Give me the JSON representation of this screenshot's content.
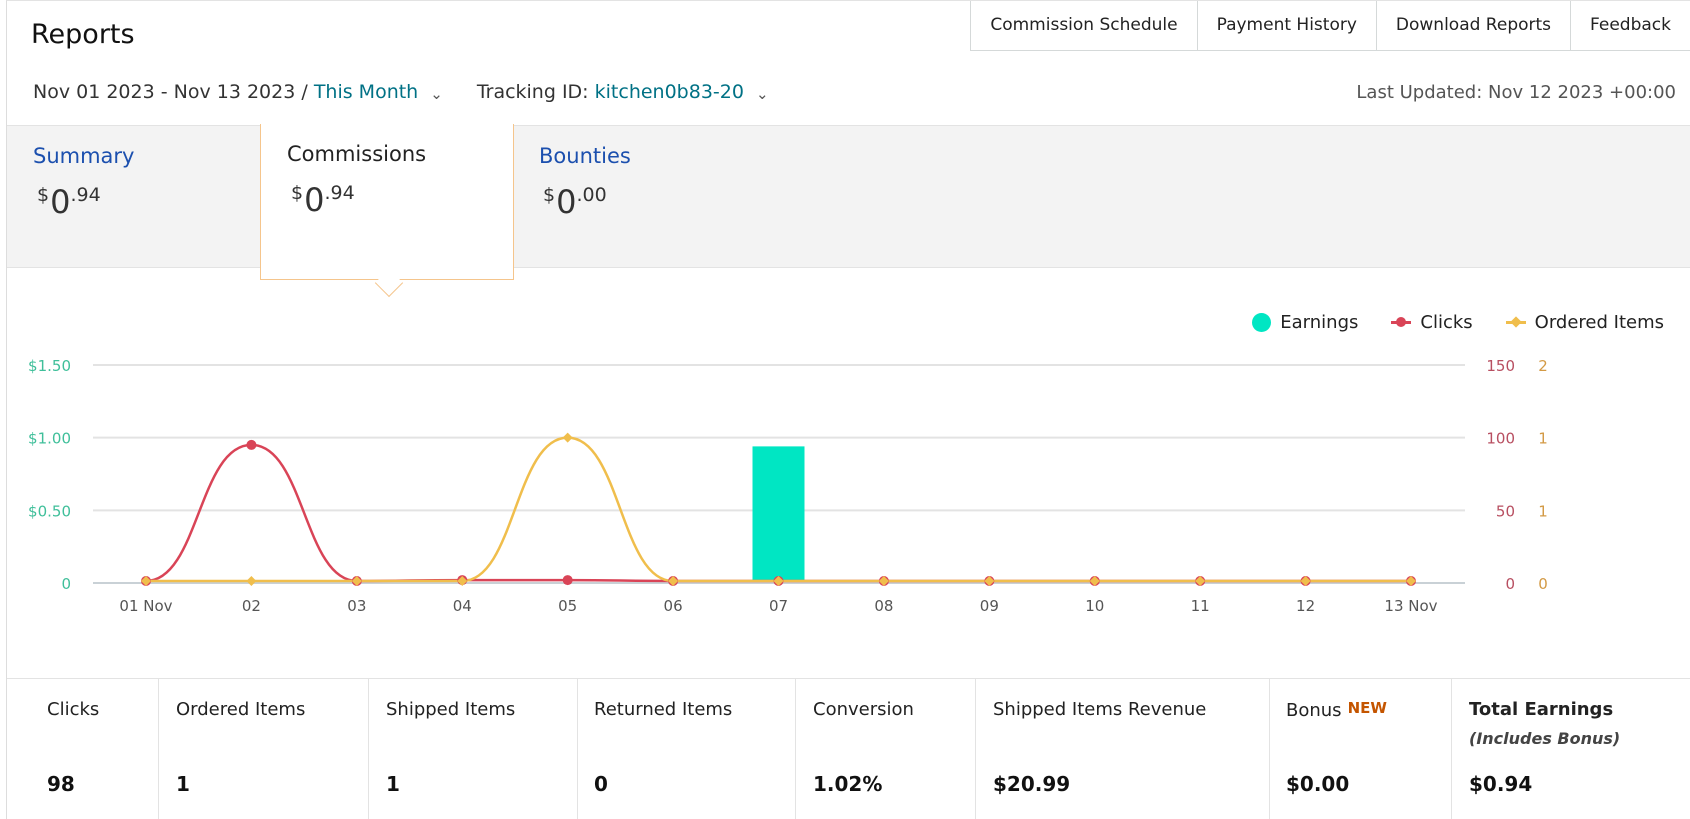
{
  "header": {
    "title": "Reports",
    "nav": [
      "Commission Schedule",
      "Payment History",
      "Download Reports",
      "Feedback"
    ]
  },
  "filters": {
    "date_range": "Nov 01 2023 - Nov 13 2023 / ",
    "period": "This Month",
    "tracking_label": "Tracking ID: ",
    "tracking_id": "kitchen0b83-20",
    "last_updated": "Last Updated: Nov 12 2023 +00:00"
  },
  "tabs": {
    "summary": {
      "label": "Summary",
      "currency": "$",
      "whole": "0",
      "cents": ".94"
    },
    "commissions": {
      "label": "Commissions",
      "currency": "$",
      "whole": "0",
      "cents": ".94"
    },
    "bounties": {
      "label": "Bounties",
      "currency": "$",
      "whole": "0",
      "cents": ".00"
    }
  },
  "legend": {
    "earnings": "Earnings",
    "clicks": "Clicks",
    "ordered": "Ordered Items"
  },
  "colors": {
    "earnings": "#00e6c3",
    "clicks": "#d94457",
    "ordered": "#f0be4c",
    "link": "#007185",
    "tab_link": "#1b4fae",
    "new_badge": "#c45500"
  },
  "chart_data": {
    "type": "bar",
    "categories": [
      "01 Nov",
      "02",
      "03",
      "04",
      "05",
      "06",
      "07",
      "08",
      "09",
      "10",
      "11",
      "12",
      "13 Nov"
    ],
    "series": [
      {
        "name": "Earnings",
        "type": "bar",
        "axis": "left",
        "values": [
          0,
          0,
          0,
          0,
          0,
          0,
          0.94,
          0,
          0,
          0,
          0,
          0,
          0
        ]
      },
      {
        "name": "Clicks",
        "type": "line",
        "axis": "right1",
        "values": [
          0,
          95,
          0,
          2,
          2,
          0,
          0,
          0,
          0,
          0,
          0,
          0,
          0
        ]
      },
      {
        "name": "Ordered Items",
        "type": "line",
        "axis": "right2",
        "values": [
          0,
          0,
          0,
          0,
          1,
          0,
          0,
          0,
          0,
          0,
          0,
          0,
          0
        ]
      }
    ],
    "y_left": {
      "ticks": [
        "0",
        "$0.50",
        "$1.00",
        "$1.50"
      ],
      "range": [
        0,
        1.5
      ]
    },
    "y_right1": {
      "ticks": [
        "0",
        "50",
        "100",
        "150"
      ],
      "range": [
        0,
        150
      ]
    },
    "y_right2": {
      "ticks": [
        "0",
        "1",
        "1",
        "2"
      ],
      "range": [
        0,
        1.5
      ]
    },
    "grid": true,
    "legend_position": "top-right"
  },
  "stats": [
    {
      "label": "Clicks",
      "value": "98"
    },
    {
      "label": "Ordered Items",
      "value": "1"
    },
    {
      "label": "Shipped Items",
      "value": "1"
    },
    {
      "label": "Returned Items",
      "value": "0"
    },
    {
      "label": "Conversion",
      "value": "1.02%"
    },
    {
      "label": "Shipped Items Revenue",
      "value": "$20.99"
    },
    {
      "label": "Bonus",
      "badge": "NEW",
      "value": "$0.00"
    },
    {
      "label": "Total Earnings",
      "sub": "(Includes Bonus)",
      "value": "$0.94"
    }
  ]
}
